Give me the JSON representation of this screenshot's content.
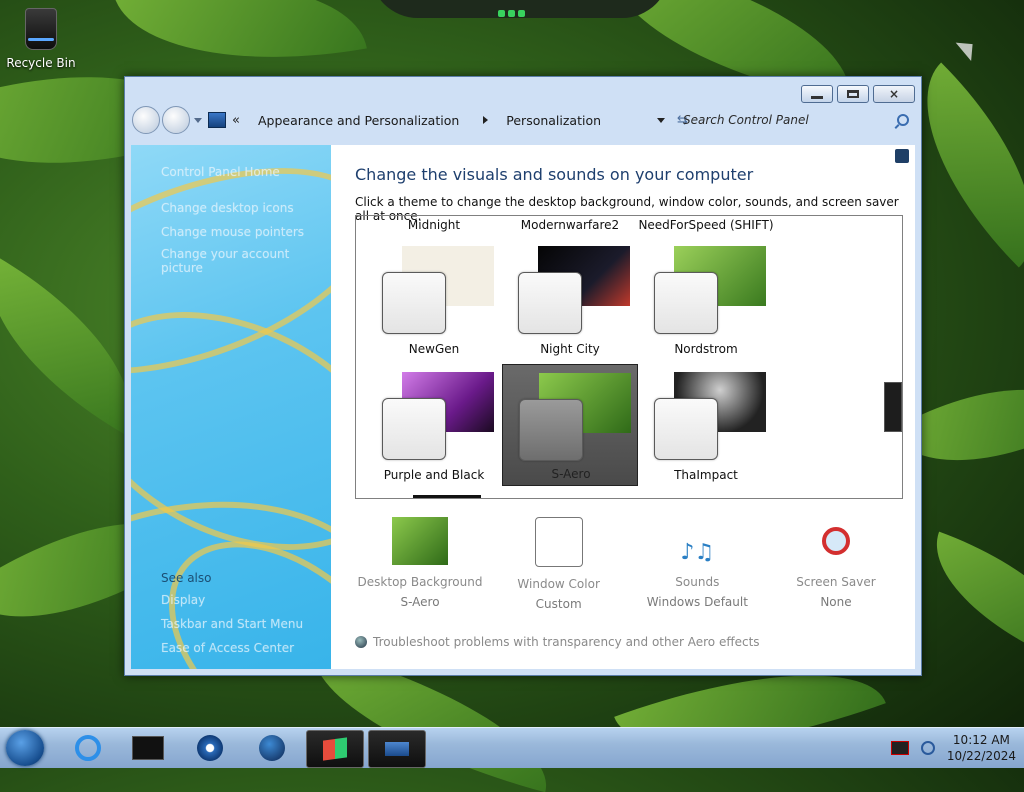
{
  "desktop": {
    "icons": [
      {
        "label": "Recycle Bin",
        "icon": "recycle-bin-icon"
      }
    ]
  },
  "window": {
    "controls": {
      "minimize": "minimize-icon",
      "maximize": "maximize-icon",
      "close": "×"
    },
    "address": {
      "back": "back-icon",
      "forward": "forward-icon",
      "overflow": "«",
      "crumbs": [
        "Appearance and Personalization",
        "Personalization"
      ],
      "refresh": "⇆",
      "search_placeholder": "Search Control Panel"
    },
    "left_pane": {
      "links": [
        "Control Panel Home",
        "Change desktop icons",
        "Change mouse pointers",
        "Change your account picture"
      ],
      "see_also_title": "See also",
      "see_also": [
        "Display",
        "Taskbar and Start Menu",
        "Ease of Access Center"
      ]
    },
    "main": {
      "title": "Change the visuals and sounds on your computer",
      "subtitle": "Click a theme to change the desktop background, window color, sounds, and screen saver all at once.",
      "top_labels": [
        "Midnight",
        "Modernwarfare2",
        "NeedForSpeed (SHIFT)"
      ],
      "themes": [
        {
          "name": "NewGen",
          "selected": false,
          "bg": "#f3efe4"
        },
        {
          "name": "Night City",
          "selected": false,
          "bg": "#101010"
        },
        {
          "name": "Nordstrom",
          "selected": false,
          "bg": "#6aa33a"
        },
        {
          "name": "Purple and Black",
          "selected": false,
          "bg": "#8b3aa8"
        },
        {
          "name": "S-Aero",
          "selected": true,
          "bg": "#4e8d27"
        },
        {
          "name": "ThaImpact",
          "selected": false,
          "bg": "#2a2a2a"
        }
      ],
      "settings": [
        {
          "name": "Desktop Background",
          "value": "S-Aero",
          "icon": "desktop-background-icon"
        },
        {
          "name": "Window Color",
          "value": "Custom",
          "icon": "window-color-icon"
        },
        {
          "name": "Sounds",
          "value": "Windows Default",
          "icon": "sounds-icon"
        },
        {
          "name": "Screen Saver",
          "value": "None",
          "icon": "screen-saver-icon"
        }
      ],
      "troubleshoot": "Troubleshoot problems with transparency and other Aero effects"
    }
  },
  "taskbar": {
    "pinned": [
      "explorer-icon",
      "internet-explorer-icon",
      "media-center-icon",
      "media-player-icon",
      "globe-icon",
      "windows-flag-icon",
      "control-panel-icon"
    ],
    "clock": {
      "time": "10:12 AM",
      "date": "10/22/2024"
    }
  }
}
